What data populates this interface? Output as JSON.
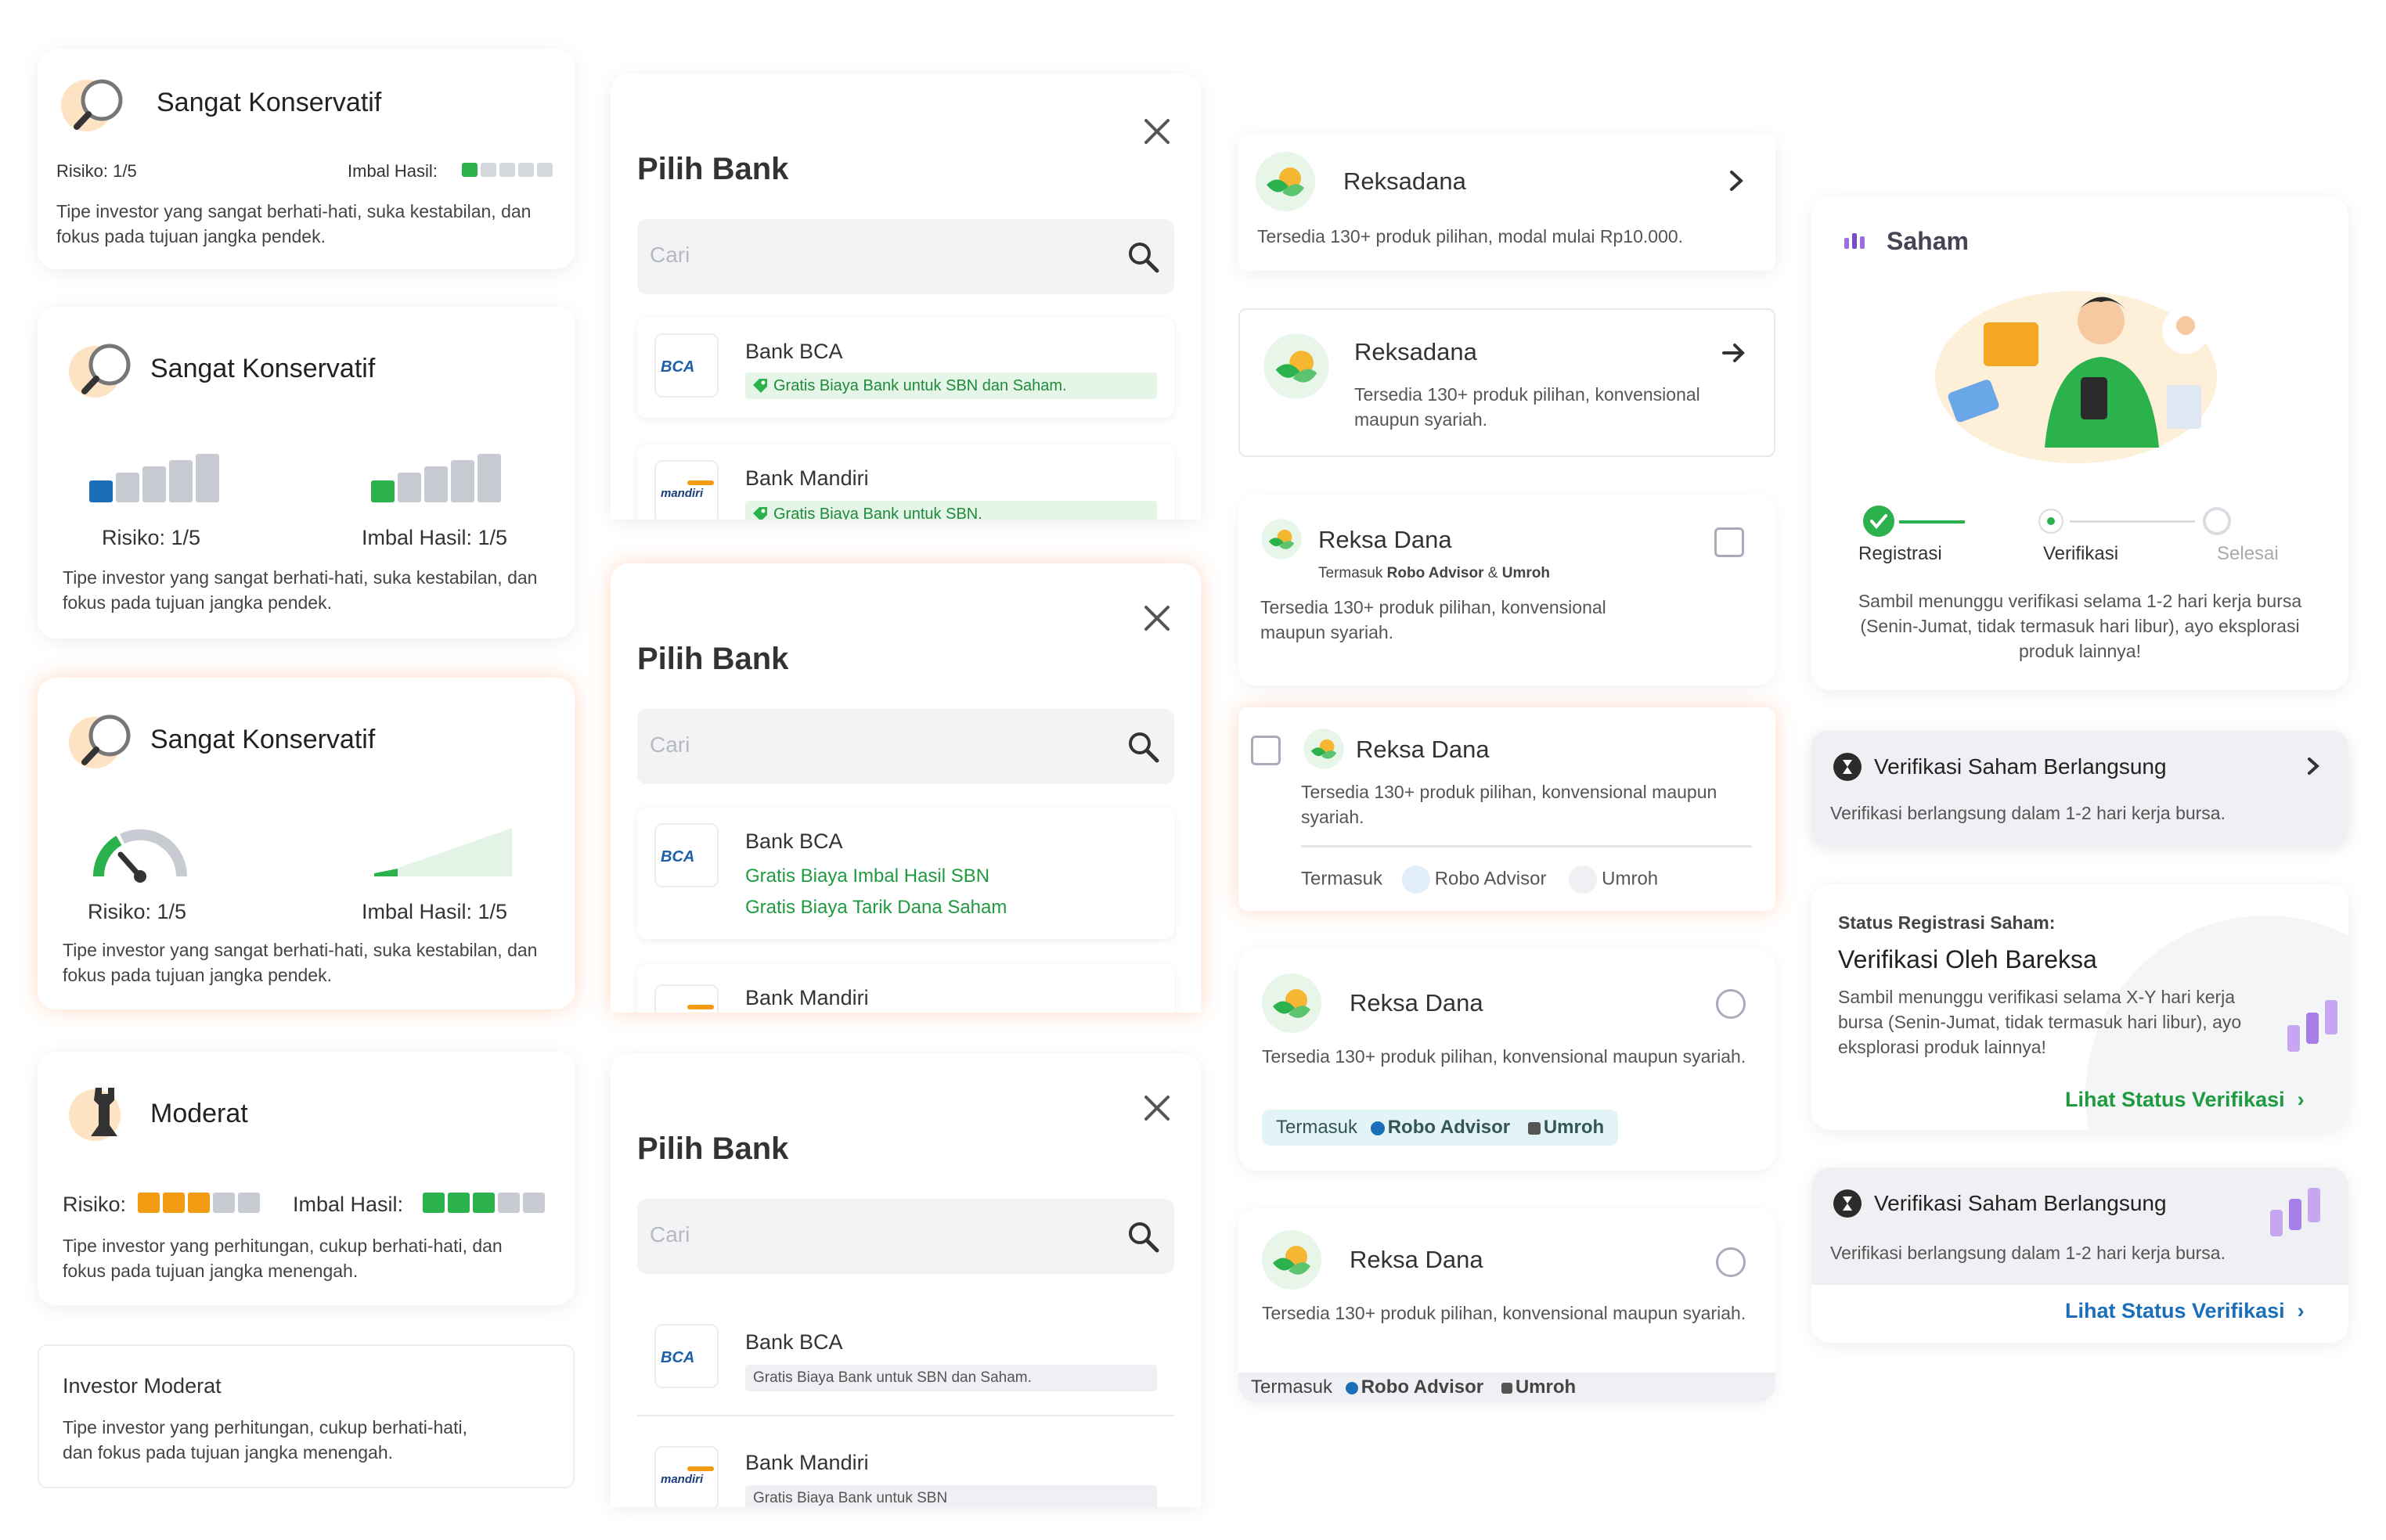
{
  "risk_cards": {
    "c1": {
      "title": "Sangat Konservatif",
      "risk_label": "Risiko: 1/5",
      "return_label": "Imbal Hasil:",
      "return_level": 1,
      "desc": "Tipe investor yang sangat berhati-hati, suka kestabilan, dan fokus pada tujuan jangka pendek."
    },
    "c2": {
      "title": "Sangat Konservatif",
      "risk_label": "Risiko: 1/5",
      "return_label": "Imbal Hasil: 1/5",
      "risk_level": 1,
      "return_level": 1,
      "desc": "Tipe investor yang sangat berhati-hati, suka kestabilan, dan fokus pada tujuan jangka pendek."
    },
    "c3": {
      "title": "Sangat Konservatif",
      "risk_label": "Risiko: 1/5",
      "return_label": "Imbal Hasil: 1/5",
      "desc": "Tipe investor yang sangat berhati-hati, suka kestabilan, dan fokus pada tujuan jangka pendek."
    },
    "c4": {
      "title": "Moderat",
      "risk_label": "Risiko:",
      "return_label": "Imbal Hasil:",
      "risk_level": 3,
      "return_level": 3,
      "desc": "Tipe investor yang perhitungan, cukup berhati-hati, dan fokus pada tujuan jangka menengah."
    },
    "c5": {
      "title": "Investor Moderat",
      "desc": "Tipe investor yang perhitungan, cukup berhati-hati, dan fokus pada tujuan jangka menengah."
    }
  },
  "bank_modals": {
    "m1": {
      "title": "Pilih Bank",
      "search_placeholder": "Cari",
      "bank1": {
        "name": "Bank BCA",
        "logo": "BCA",
        "note": "Gratis Biaya Bank untuk SBN dan Saham."
      },
      "bank2": {
        "name": "Bank Mandiri",
        "logo": "mandiri",
        "note": "Gratis Biaya Bank untuk SBN."
      }
    },
    "m2": {
      "title": "Pilih Bank",
      "search_placeholder": "Cari",
      "bank1": {
        "name": "Bank BCA",
        "logo": "BCA",
        "note1": "Gratis Biaya Imbal Hasil SBN",
        "note2": "Gratis Biaya Tarik Dana Saham"
      },
      "bank2": {
        "name": "Bank Mandiri"
      }
    },
    "m3": {
      "title": "Pilih Bank",
      "search_placeholder": "Cari",
      "bank1": {
        "name": "Bank BCA",
        "logo": "BCA",
        "note": "Gratis Biaya Bank untuk SBN dan Saham."
      },
      "bank2": {
        "name": "Bank Mandiri",
        "logo": "mandiri",
        "note": "Gratis Biaya Bank untuk SBN"
      }
    }
  },
  "products": {
    "p1": {
      "name": "Reksadana",
      "desc": "Tersedia 130+ produk pilihan, modal mulai Rp10.000."
    },
    "p2": {
      "name": "Reksadana",
      "desc": "Tersedia 130+ produk pilihan, konvensional maupun syariah."
    },
    "p3": {
      "name": "Reksa Dana",
      "tag_prefix": "Termasuk",
      "tag_a": "Robo Advisor",
      "tag_amp": "&",
      "tag_b": "Umroh",
      "desc": "Tersedia 130+ produk pilihan, konvensional maupun syariah."
    },
    "p4": {
      "name": "Reksa Dana",
      "desc": "Tersedia 130+ produk pilihan, konvensional maupun syariah.",
      "tag_prefix": "Termasuk",
      "tag_a": "Robo Advisor",
      "tag_b": "Umroh"
    },
    "p5": {
      "name": "Reksa Dana",
      "desc": "Tersedia 130+ produk pilihan, konvensional maupun syariah.",
      "tag_prefix": "Termasuk",
      "tag_a": "Robo Advisor",
      "tag_b": "Umroh"
    },
    "p6": {
      "name": "Reksa Dana",
      "desc": "Tersedia 130+ produk pilihan, konvensional maupun syariah.",
      "tag_prefix": "Termasuk",
      "tag_a": "Robo Advisor",
      "tag_b": "Umroh"
    }
  },
  "saham": {
    "title": "Saham",
    "steps": [
      "Registrasi",
      "Verifikasi",
      "Selesai"
    ],
    "desc": "Sambil menunggu verifikasi selama 1-2 hari kerja bursa (Senin-Jumat, tidak termasuk hari libur), ayo eksplorasi produk lainnya!"
  },
  "verif1": {
    "title": "Verifikasi Saham Berlangsung",
    "desc": "Verifikasi berlangsung dalam 1-2 hari kerja bursa."
  },
  "status": {
    "label": "Status Registrasi Saham:",
    "title": "Verifikasi Oleh Bareksa",
    "desc": "Sambil menunggu verifikasi selama X-Y hari kerja bursa (Senin-Jumat, tidak termasuk hari libur), ayo eksplorasi produk lainnya!",
    "link": "Lihat Status Verifikasi"
  },
  "verif2": {
    "title": "Verifikasi Saham Berlangsung",
    "desc": "Verifikasi berlangsung dalam 1-2 hari kerja bursa.",
    "link": "Lihat Status Verifikasi"
  },
  "colors": {
    "green": "#2bb24c",
    "blue": "#1b6fb8",
    "orange": "#f39c12",
    "gray": "#c8ccd2",
    "dark_green": "#1f8a3a",
    "purple": "#7b4ac9"
  }
}
